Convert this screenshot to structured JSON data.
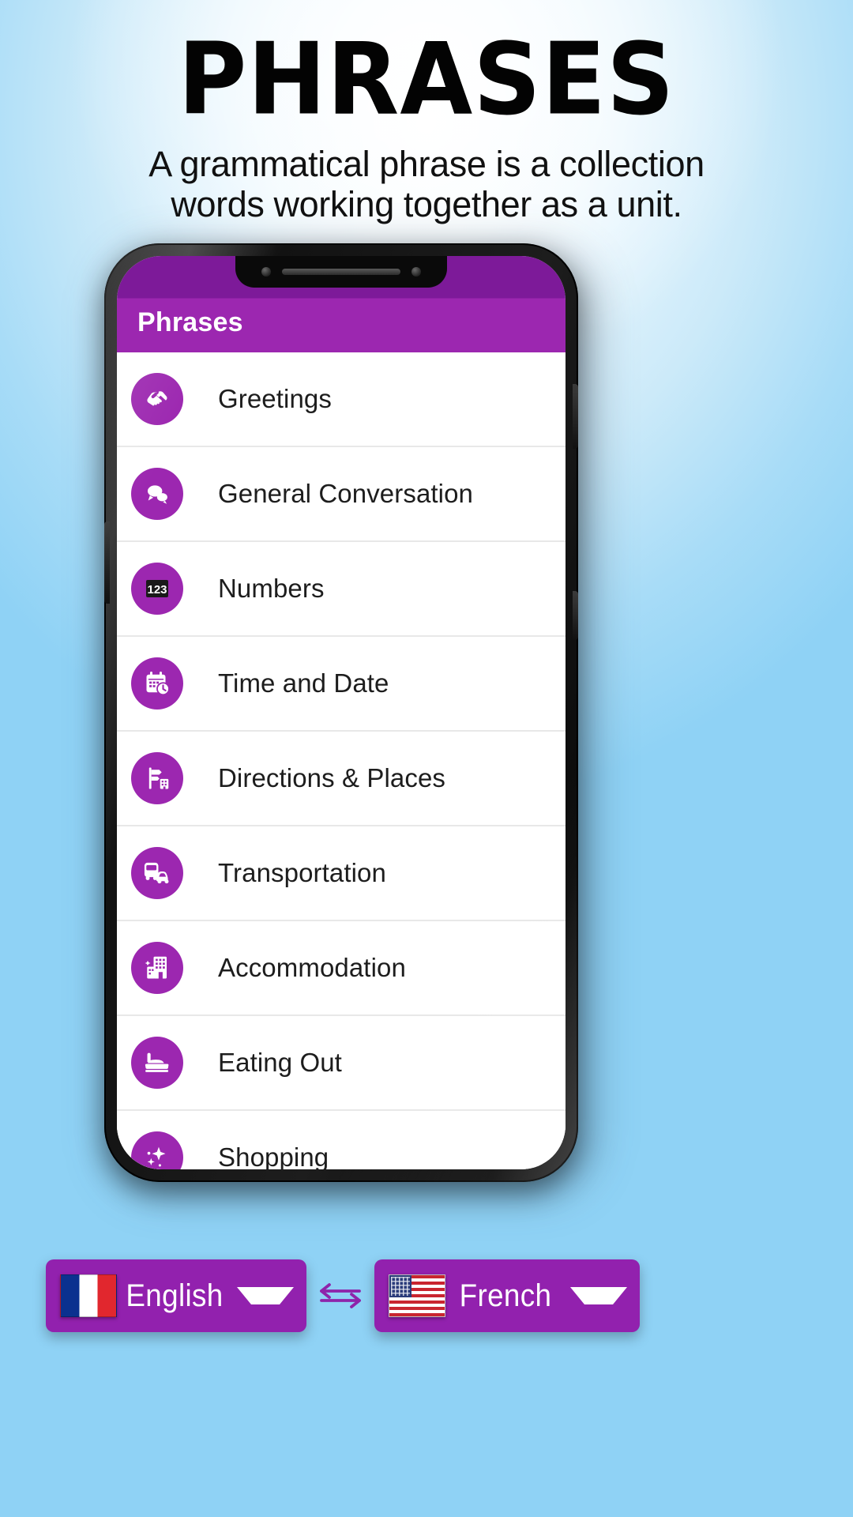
{
  "hero": {
    "title": "PHRASES",
    "subtitle_line1": "A grammatical phrase is a collection",
    "subtitle_line2": "words working together as a unit."
  },
  "app": {
    "title": "Phrases",
    "accent_color": "#9c27b0",
    "app_bar_color": "#7d1a99",
    "items": [
      {
        "label": "Greetings",
        "icon": "handshake-icon"
      },
      {
        "label": "General Conversation",
        "icon": "chat-bubbles-icon"
      },
      {
        "label": "Numbers",
        "icon": "numbers-123-icon"
      },
      {
        "label": "Time and Date",
        "icon": "calendar-clock-icon"
      },
      {
        "label": "Directions & Places",
        "icon": "signpost-icon"
      },
      {
        "label": "Transportation",
        "icon": "bus-car-icon"
      },
      {
        "label": "Accommodation",
        "icon": "hotel-building-icon"
      },
      {
        "label": "Eating Out",
        "icon": "food-tray-icon"
      },
      {
        "label": "Shopping",
        "icon": "shopping-sparkle-icon"
      }
    ]
  },
  "language_bar": {
    "source": {
      "name": "English",
      "flag": "flag-france",
      "caret": "chevron-down-icon"
    },
    "swap_icon": "swap-arrows-icon",
    "target": {
      "name": "French",
      "flag": "flag-usa",
      "caret": "chevron-down-icon"
    },
    "pill_color": "#9221ae"
  }
}
